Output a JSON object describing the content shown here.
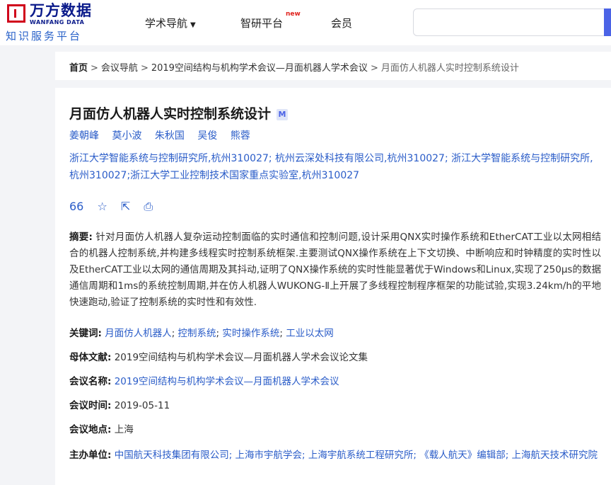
{
  "header": {
    "logo_cn": "万方数据",
    "logo_en": "WANFANG DATA",
    "logo_sub": "知识服务平台",
    "nav": {
      "academic": "学术导航",
      "zhiyan": "智研平台",
      "new_badge": "new",
      "member": "会员"
    },
    "search": {
      "placeholder": ""
    }
  },
  "breadcrumb": {
    "home": "首页",
    "conf_nav": "会议导航",
    "conference": "2019空间结构与机构学术会议—月面机器人学术会议",
    "current": "月面仿人机器人实时控制系统设计"
  },
  "paper": {
    "title": "月面仿人机器人实时控制系统设计",
    "badge": "M",
    "authors": [
      "姜朝峰",
      "莫小波",
      "朱秋国",
      "吴俊",
      "熊蓉"
    ],
    "affiliations": "浙江大学智能系统与控制研究所,杭州310027; 杭州云深处科技有限公司,杭州310027; 浙江大学智能系统与控制研究所,杭州310027;浙江大学工业控制技术国家重点实验室,杭州310027",
    "tools": {
      "cite": "66",
      "star": "☆",
      "share": "⇱",
      "print": "⎙"
    },
    "abstract_label": "摘要:",
    "abstract": "针对月面仿人机器人复杂运动控制面临的实时通信和控制问题,设计采用QNX实时操作系统和EtherCAT工业以太网相结合的机器人控制系统,并构建多线程实时控制系统框架.主要测试QNX操作系统在上下文切换、中断响应和时钟精度的实时性以及EtherCAT工业以太网的通信周期及其抖动,证明了QNX操作系统的实时性能显著优于Windows和Linux,实现了250μs的数据通信周期和1ms的系统控制周期,并在仿人机器人WUKONG-Ⅱ上开展了多线程控制程序框架的功能试验,实现3.24km/h的平地快速跑动,验证了控制系统的实时性和有效性.",
    "keywords_label": "关键词:",
    "keywords": [
      "月面仿人机器人",
      "控制系统",
      "实时操作系统",
      "工业以太网"
    ],
    "parent_label": "母体文献:",
    "parent": "2019空间结构与机构学术会议—月面机器人学术会议论文集",
    "conf_name_label": "会议名称:",
    "conf_name": "2019空间结构与机构学术会议—月面机器人学术会议",
    "conf_date_label": "会议时间:",
    "conf_date": "2019-05-11",
    "conf_place_label": "会议地点:",
    "conf_place": "上海",
    "organizer_label": "主办单位:",
    "organizers": "中国航天科技集团有限公司; 上海市宇航学会; 上海宇航系统工程研究所; 《载人航天》编辑部; 上海航天技术研究院"
  }
}
